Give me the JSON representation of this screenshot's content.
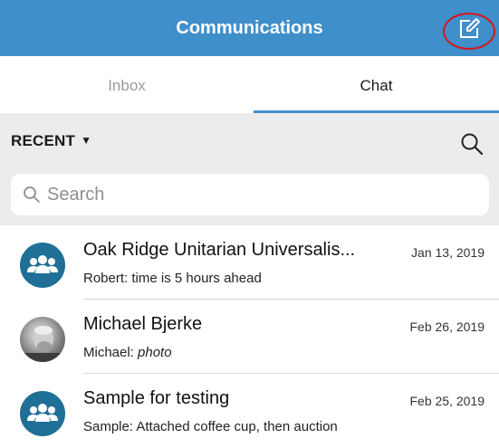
{
  "header": {
    "title": "Communications",
    "compose_icon": "compose-icon",
    "accent_color": "#3f8fca",
    "highlight_color": "#d6161c"
  },
  "tabs": [
    {
      "label": "Inbox",
      "active": false
    },
    {
      "label": "Chat",
      "active": true
    }
  ],
  "filter": {
    "label": "RECENT",
    "caret": "▼",
    "search_icon": "search-icon"
  },
  "search": {
    "placeholder": "Search"
  },
  "conversations": [
    {
      "title": "Oak Ridge Unitarian Universalis...",
      "date": "Jan 13, 2019",
      "sender": "Robert:",
      "preview": "time is 5 hours ahead",
      "preview_italic": false,
      "avatar": "group-icon"
    },
    {
      "title": "Michael Bjerke",
      "date": "Feb 26, 2019",
      "sender": "Michael:",
      "preview": "photo",
      "preview_italic": true,
      "avatar": "user-photo"
    },
    {
      "title": "Sample for testing",
      "date": "Feb 25, 2019",
      "sender": "Sample:",
      "preview": "Attached coffee cup, then auction",
      "preview_italic": false,
      "avatar": "group-icon"
    }
  ]
}
